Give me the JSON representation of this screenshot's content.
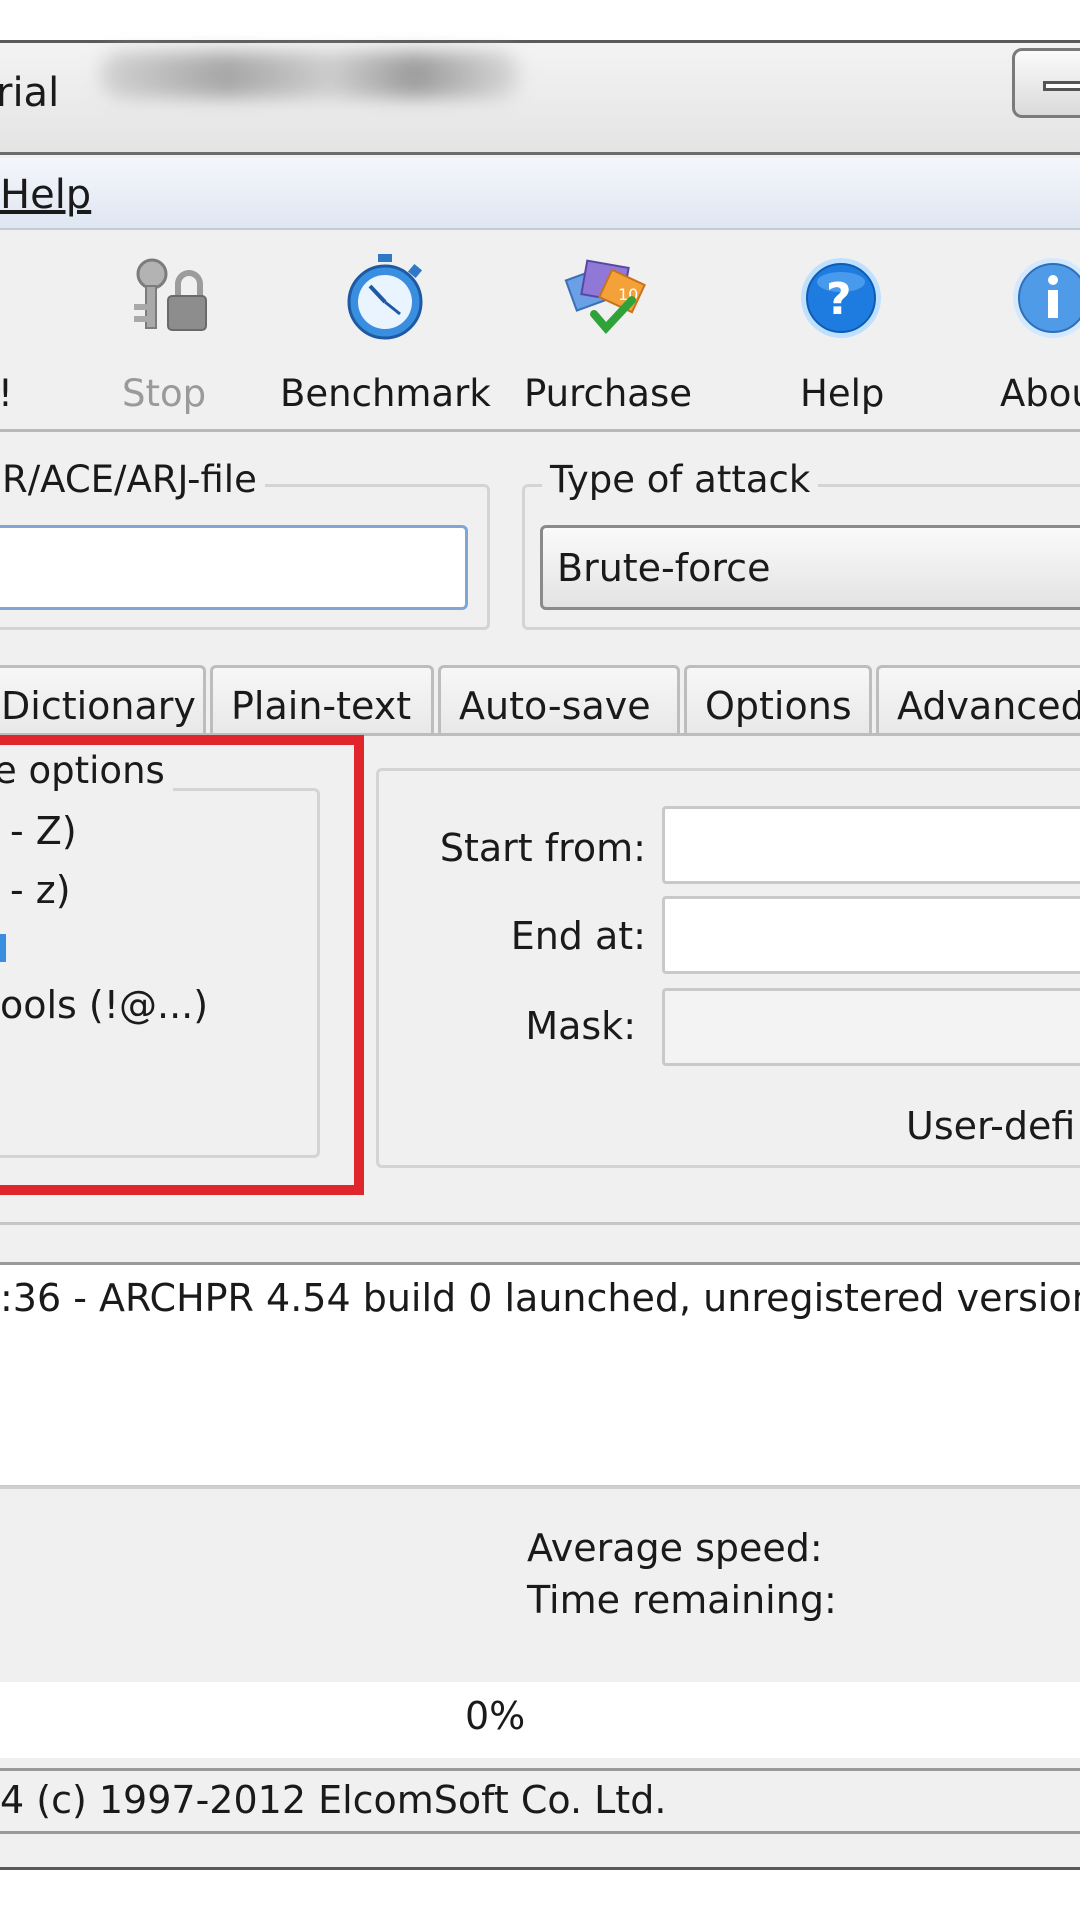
{
  "window": {
    "title_fragment": "rial"
  },
  "menu": {
    "help": "Help"
  },
  "toolbar": {
    "start_fragment": "!",
    "stop": "Stop",
    "benchmark": "Benchmark",
    "purchase": "Purchase",
    "help": "Help",
    "about_fragment": "Abou"
  },
  "file_group": {
    "title": "R/ACE/ARJ-file",
    "value": ""
  },
  "attack_group": {
    "title": "Type of attack",
    "selected": "Brute-force"
  },
  "tabs": [
    {
      "label": "Dictionary"
    },
    {
      "label": "Plain-text"
    },
    {
      "label": "Auto-save"
    },
    {
      "label": "Options"
    },
    {
      "label": "Advanced"
    }
  ],
  "range_options": {
    "title": "e options",
    "items": [
      {
        "label": "- Z)"
      },
      {
        "label": "- z)"
      },
      {
        "label": ""
      },
      {
        "label": "ools (!@...)"
      }
    ]
  },
  "fields": {
    "start_from_label": "Start from:",
    "end_at_label": "End at:",
    "mask_label": "Mask:",
    "user_defined_fragment": "User-defi"
  },
  "log": {
    "line": ":36 - ARCHPR 4.54 build 0 launched, unregistered version"
  },
  "status": {
    "average_speed": "Average speed:",
    "time_remaining": "Time remaining:",
    "progress": "0%",
    "copyright": "4 (c) 1997-2012 ElcomSoft Co. Ltd."
  },
  "colors": {
    "highlight": "#e0252c",
    "input_focus_border": "#7ea7d6",
    "help_icon_blue": "#1e7be0"
  }
}
